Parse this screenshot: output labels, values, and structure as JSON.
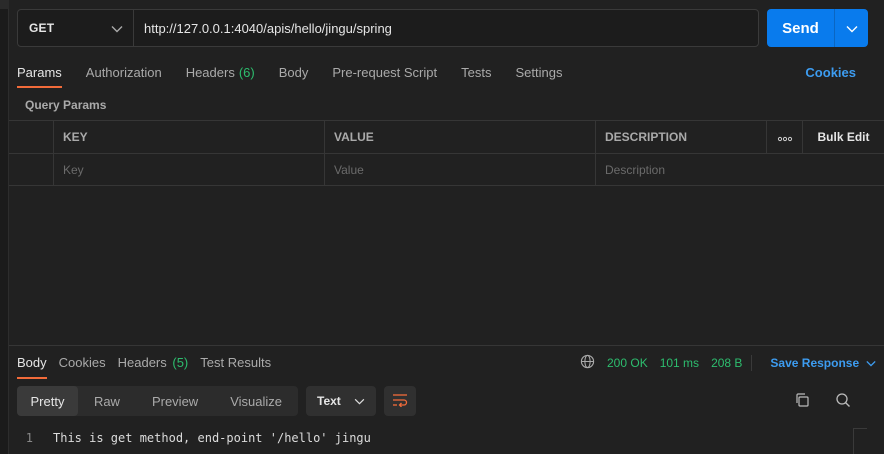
{
  "request": {
    "method": "GET",
    "url": "http://127.0.0.1:4040/apis/hello/jingu/spring",
    "send_label": "Send"
  },
  "tabs": [
    {
      "label": "Params",
      "count": ""
    },
    {
      "label": "Authorization",
      "count": ""
    },
    {
      "label": "Headers",
      "count": "(6)"
    },
    {
      "label": "Body",
      "count": ""
    },
    {
      "label": "Pre-request Script",
      "count": ""
    },
    {
      "label": "Tests",
      "count": ""
    },
    {
      "label": "Settings",
      "count": ""
    }
  ],
  "cookies_label": "Cookies",
  "query_params": {
    "title": "Query Params",
    "headers": {
      "key": "KEY",
      "value": "VALUE",
      "description": "DESCRIPTION",
      "bulk_edit": "Bulk Edit"
    },
    "placeholders": {
      "key": "Key",
      "value": "Value",
      "description": "Description"
    }
  },
  "response": {
    "tabs": [
      {
        "label": "Body",
        "count": ""
      },
      {
        "label": "Cookies",
        "count": ""
      },
      {
        "label": "Headers",
        "count": "(5)"
      },
      {
        "label": "Test Results",
        "count": ""
      }
    ],
    "status": "200 OK",
    "time": "101 ms",
    "size": "208 B",
    "save_label": "Save Response",
    "views": [
      "Pretty",
      "Raw",
      "Preview",
      "Visualize"
    ],
    "format": "Text",
    "lines": [
      {
        "num": "1",
        "text": "This is get method, end-point '/hello' jingu"
      }
    ]
  },
  "colors": {
    "accent": "#f26b3a",
    "send": "#097bed",
    "ok": "#2dbd6e",
    "link": "#3d9cf0"
  }
}
